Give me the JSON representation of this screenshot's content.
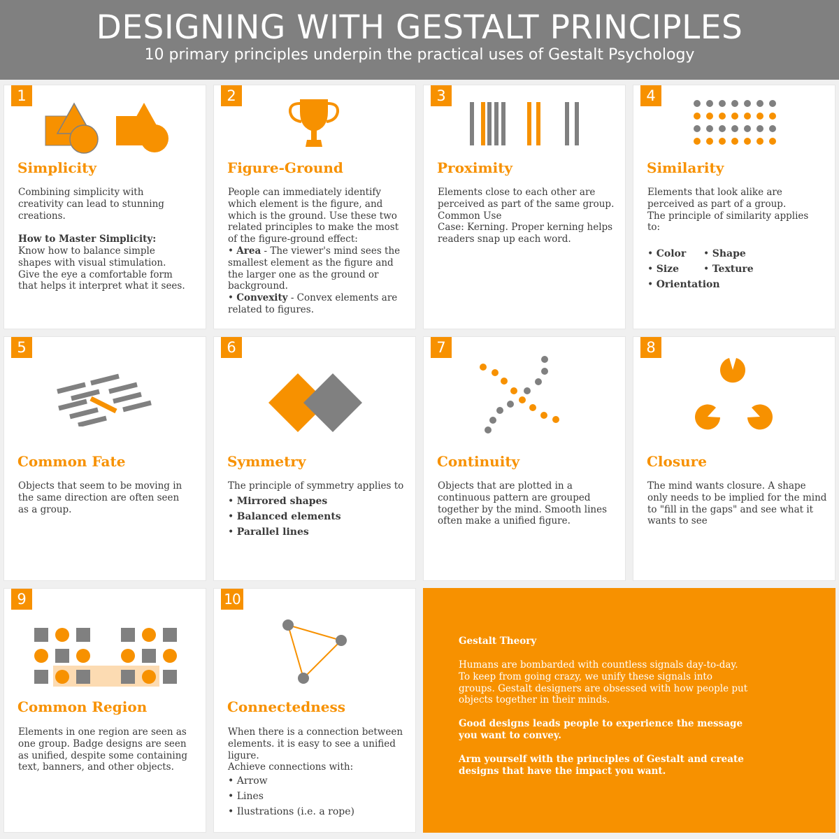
{
  "header": {
    "title": "DESIGNING WITH GESTALT PRINCIPLES",
    "subtitle": "10 primary principles underpin the practical uses of Gestalt Psychology"
  },
  "colors": {
    "accent": "#f79100",
    "gray": "#808080",
    "light_accent": "#fcdbb2"
  },
  "cards": [
    {
      "number": "1",
      "title": "Simplicity",
      "icon": "simplicity-icon",
      "body": [
        "Combining simplicity with",
        "creativity can lead to stunning",
        "creations."
      ],
      "subhead": "How to Master Simplicity:",
      "body2": [
        "Know how to balance simple",
        "shapes with visual stimulation.",
        "Give the eye a comfortable form",
        "that helps it interpret what it sees."
      ]
    },
    {
      "number": "2",
      "title": "Figure-Ground",
      "icon": "trophy-icon",
      "body": [
        "People can immediately identify",
        "which element is the figure, and",
        "which is the ground. Use these two",
        "related principles to make the most",
        "of the figure-ground effect:"
      ],
      "area_label": "Area",
      "area_text": [
        " - The viewer's mind sees the",
        "smallest element as the figure and",
        "the larger one as the ground or",
        "background."
      ],
      "convexity_label": "Convexity",
      "convexity_text": [
        " - Convex elements are",
        "related to figures."
      ]
    },
    {
      "number": "3",
      "title": "Proximity",
      "icon": "proximity-bars-icon",
      "body": [
        "Elements close to each other are",
        "perceived as part of the same group.",
        "Common Use",
        "Case: Kerning. Proper kerning helps",
        "readers snap up each word."
      ]
    },
    {
      "number": "4",
      "title": "Similarity",
      "icon": "dot-grid-icon",
      "body": [
        "Elements that look alike are",
        "perceived as part of a group.",
        "The principle of similarity applies",
        "to:"
      ],
      "bullets_left": [
        "Color",
        "Size",
        "Orientation"
      ],
      "bullets_right": [
        "Shape",
        "Texture"
      ]
    },
    {
      "number": "5",
      "title": "Common Fate",
      "icon": "moving-lines-icon",
      "body": [
        "Objects that seem to be moving in",
        "the same direction are often seen",
        "as a group."
      ]
    },
    {
      "number": "6",
      "title": "Symmetry",
      "icon": "diamonds-icon",
      "body": [
        "The principle of symmetry applies to"
      ],
      "bullets": [
        "Mirrored shapes",
        "Balanced elements",
        "Parallel lines"
      ]
    },
    {
      "number": "7",
      "title": "Continuity",
      "icon": "crossing-dots-icon",
      "body": [
        "Objects that are plotted in a",
        "continuous pattern are grouped",
        "together by the mind. Smooth lines",
        "often make a unified figure."
      ]
    },
    {
      "number": "8",
      "title": "Closure",
      "icon": "pacman-triangle-icon",
      "body": [
        "The mind wants closure. A shape",
        "only needs to be implied for the mind",
        "to \"fill in the gaps\" and see what it",
        "wants to see"
      ]
    },
    {
      "number": "9",
      "title": "Common Region",
      "icon": "region-grid-icon",
      "body": [
        "Elements in one region are seen as",
        "one group. Badge designs are seen",
        "as unified, despite some containing",
        "text, banners, and other objects."
      ]
    },
    {
      "number": "10",
      "title": "Connectedness",
      "icon": "connected-nodes-icon",
      "body": [
        "When there is a connection between",
        "elements. it is easy to see a unified",
        "ligure.",
        "Achieve connections with:"
      ],
      "bullets": [
        "Arrow",
        "Lines",
        "Ilustrations (i.e. a rope)"
      ]
    }
  ],
  "summary": {
    "heading": "Gestalt Theory",
    "para1": [
      "Humans are bombarded with countless signals day-to-day.",
      "To keep from going crazy, we unify these signals into",
      "groups. Gestalt designers are obsessed with how people put",
      "objects together in their minds."
    ],
    "para2": [
      "Good designs leads people to experience the message",
      "you want to convey."
    ],
    "para3": [
      "Arm yourself with the principles of Gestalt and create",
      "designs that have the impact you want."
    ]
  }
}
